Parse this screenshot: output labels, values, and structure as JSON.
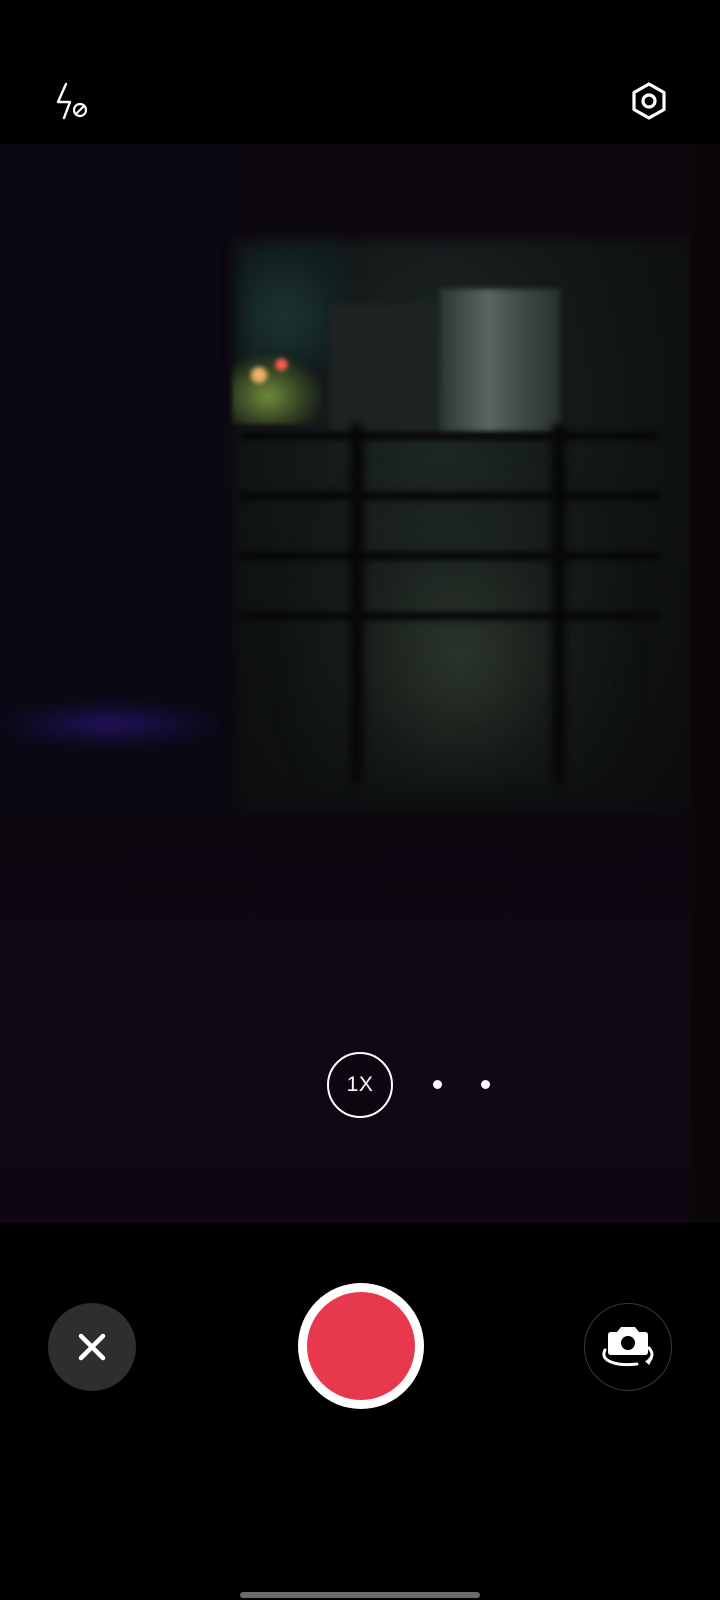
{
  "top_bar": {
    "flash_icon": "flash-off-icon",
    "settings_icon": "settings-hexagon-icon"
  },
  "zoom": {
    "current_label": "1X",
    "dot_count": 2
  },
  "controls": {
    "close_icon": "close-icon",
    "record_color": "#e8384d",
    "switch_camera_icon": "camera-switch-icon"
  },
  "colors": {
    "background": "#000000",
    "close_button_bg": "#2e2e2e",
    "record_ring": "#ffffff"
  }
}
